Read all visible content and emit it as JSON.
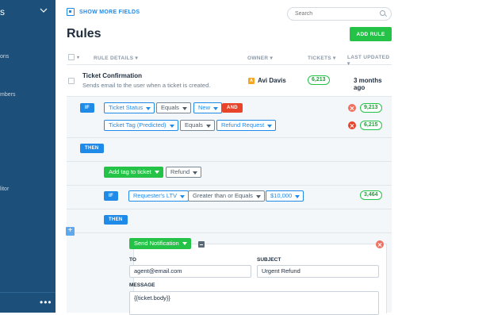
{
  "sidebar": {
    "top_label": "s",
    "nav_items": [
      "ons",
      "mbers",
      "litor"
    ],
    "more": "•••"
  },
  "toolbar": {
    "show_more_fields": "SHOW MORE FIELDS",
    "search_placeholder": "Search",
    "page_title": "Rules",
    "add_rule": "ADD RULE"
  },
  "table": {
    "columns": {
      "rule_details": "RULE DETAILS ▾",
      "owner": "OWNER ▾",
      "tickets": "TICKETS ▾",
      "last_updated": "LAST UPDATED ▾"
    },
    "rows": [
      {
        "name": "Ticket Confirmation",
        "description": "Sends email to the user when a ticket is created.",
        "owner_initial": "A",
        "owner": "Avi Davis",
        "tickets": "6,213",
        "updated": "3 months ago"
      }
    ]
  },
  "rule": {
    "if_label": "IF",
    "and_label": "AND",
    "then_label": "THEN",
    "condition1": {
      "field": "Ticket Status",
      "operator": "Equals",
      "value": "New",
      "count": "9,213"
    },
    "condition2": {
      "field": "Ticket Tag (Predicted)",
      "operator": "Equals",
      "value": "Refund Request",
      "count": "6,215"
    },
    "action1": {
      "action": "Add tag to ticket",
      "value": "Refund"
    },
    "nested_if": {
      "field": "Requester's LTV",
      "operator": "Greater than or Equals",
      "value": "$10,000",
      "count": "3,464"
    },
    "plus": "+",
    "notification": {
      "action": "Send Notification",
      "to_label": "TO",
      "to_value": "agent@email.com",
      "subject_label": "SUBJECT",
      "subject_value": "Urgent Refund",
      "message_label": "MESSAGE",
      "message_value": "{{ticket.body}}"
    }
  }
}
